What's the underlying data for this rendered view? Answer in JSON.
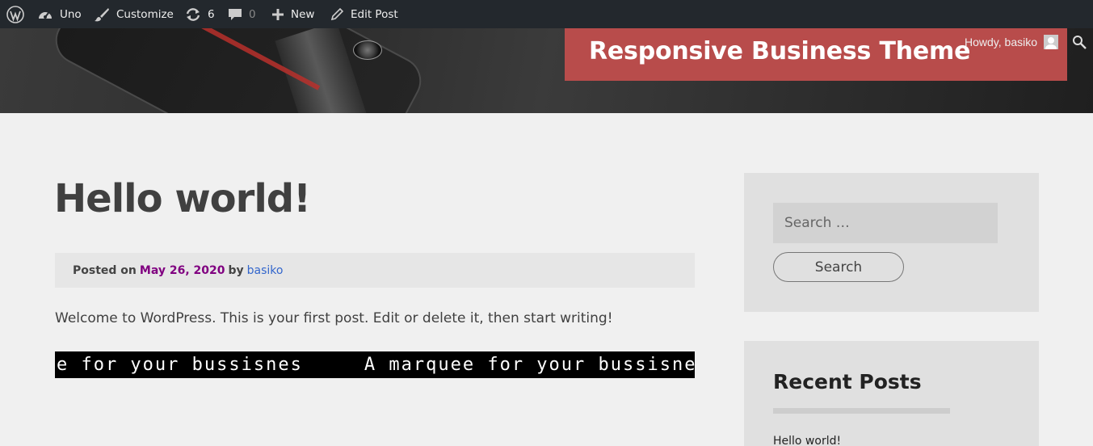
{
  "adminbar": {
    "site_name": "Uno",
    "customize_label": "Customize",
    "updates_count": "6",
    "comments_count": "0",
    "new_label": "New",
    "edit_post_label": "Edit Post",
    "howdy": "Howdy, basiko"
  },
  "header": {
    "site_title": "Responsive Business Theme"
  },
  "post": {
    "title": "Hello world!",
    "meta": {
      "posted_on": "Posted on",
      "date": "May 26, 2020",
      "by": "by",
      "author": "basiko"
    },
    "content": "Welcome to WordPress. This is your first post. Edit or delete it, then start writing!",
    "marquee_text": "A marquee for your bussisnes"
  },
  "sidebar": {
    "search": {
      "placeholder": "Search …",
      "button_label": "Search"
    },
    "recent_posts": {
      "title": "Recent Posts",
      "items": [
        "Hello world!"
      ]
    }
  },
  "colors": {
    "adminbar_bg": "#23282d",
    "title_box": "#b84c4b",
    "date_link": "#800080",
    "author_link": "#3366cc"
  }
}
